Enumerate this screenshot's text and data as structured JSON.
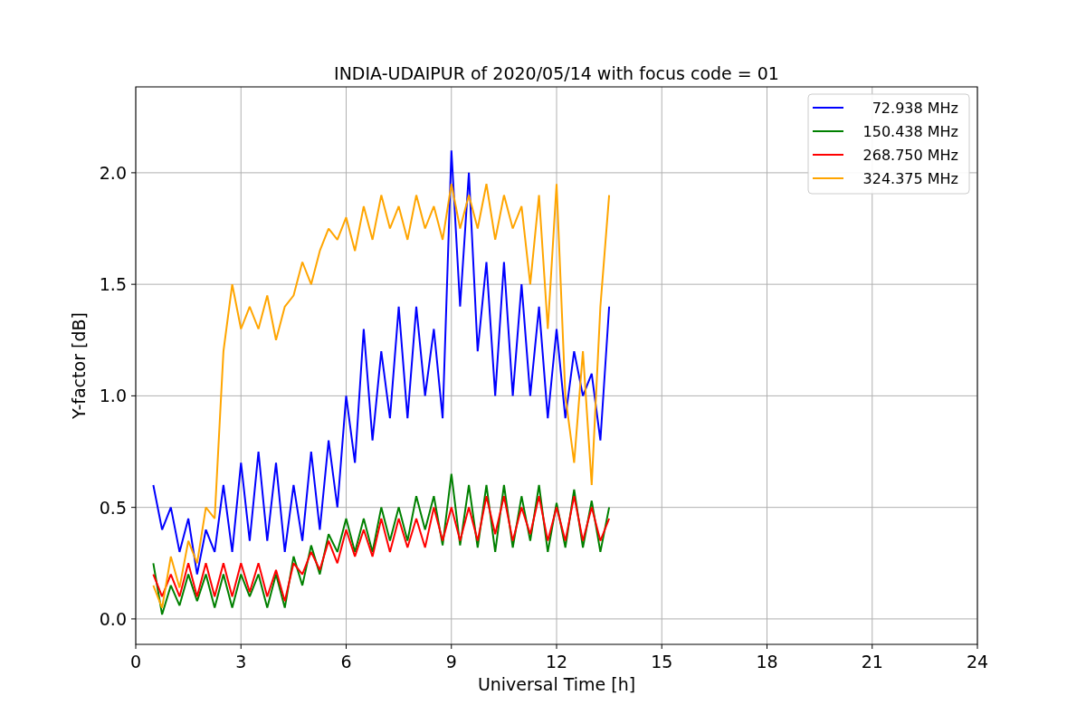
{
  "figure": {
    "chart_data": {
      "type": "line",
      "title": "INDIA-UDAIPUR of 2020/05/14 with focus code = 01",
      "xlabel": "Universal Time [h]",
      "ylabel": "Y-factor [dB]",
      "x": [
        0.5,
        0.75,
        1.0,
        1.25,
        1.5,
        1.75,
        2.0,
        2.25,
        2.5,
        2.75,
        3.0,
        3.25,
        3.5,
        3.75,
        4.0,
        4.25,
        4.5,
        4.75,
        5.0,
        5.25,
        5.5,
        5.75,
        6.0,
        6.25,
        6.5,
        6.75,
        7.0,
        7.25,
        7.5,
        7.75,
        8.0,
        8.25,
        8.5,
        8.75,
        9.0,
        9.25,
        9.5,
        9.75,
        10.0,
        10.25,
        10.5,
        10.75,
        11.0,
        11.25,
        11.5,
        11.75,
        12.0,
        12.25,
        12.5,
        12.75,
        13.0,
        13.25,
        13.5
      ],
      "series": [
        {
          "name": "72.938 MHz",
          "color": "#0000ff",
          "values": [
            0.6,
            0.4,
            0.5,
            0.3,
            0.45,
            0.2,
            0.4,
            0.3,
            0.6,
            0.3,
            0.7,
            0.35,
            0.75,
            0.35,
            0.7,
            0.3,
            0.6,
            0.35,
            0.75,
            0.4,
            0.8,
            0.5,
            1.0,
            0.7,
            1.3,
            0.8,
            1.2,
            0.9,
            1.4,
            0.9,
            1.4,
            1.0,
            1.3,
            0.9,
            2.1,
            1.4,
            2.0,
            1.2,
            1.6,
            1.0,
            1.6,
            1.0,
            1.5,
            1.0,
            1.4,
            0.9,
            1.3,
            0.9,
            1.2,
            1.0,
            1.1,
            0.8,
            1.4
          ]
        },
        {
          "name": "150.438 MHz",
          "color": "#008000",
          "values": [
            0.25,
            0.02,
            0.15,
            0.06,
            0.2,
            0.08,
            0.2,
            0.05,
            0.2,
            0.05,
            0.2,
            0.1,
            0.2,
            0.05,
            0.2,
            0.05,
            0.28,
            0.15,
            0.33,
            0.2,
            0.38,
            0.3,
            0.45,
            0.3,
            0.45,
            0.3,
            0.5,
            0.35,
            0.5,
            0.35,
            0.55,
            0.4,
            0.55,
            0.33,
            0.65,
            0.33,
            0.6,
            0.32,
            0.6,
            0.3,
            0.6,
            0.32,
            0.55,
            0.35,
            0.6,
            0.3,
            0.52,
            0.32,
            0.58,
            0.32,
            0.53,
            0.3,
            0.5
          ]
        },
        {
          "name": "268.750 MHz",
          "color": "#ff0000",
          "values": [
            0.2,
            0.1,
            0.2,
            0.1,
            0.25,
            0.1,
            0.25,
            0.1,
            0.25,
            0.1,
            0.25,
            0.12,
            0.25,
            0.1,
            0.22,
            0.08,
            0.25,
            0.2,
            0.3,
            0.22,
            0.35,
            0.25,
            0.4,
            0.28,
            0.4,
            0.28,
            0.45,
            0.3,
            0.45,
            0.32,
            0.45,
            0.32,
            0.5,
            0.35,
            0.5,
            0.35,
            0.5,
            0.35,
            0.55,
            0.38,
            0.55,
            0.35,
            0.5,
            0.38,
            0.55,
            0.35,
            0.5,
            0.35,
            0.55,
            0.35,
            0.5,
            0.35,
            0.45
          ]
        },
        {
          "name": "324.375 MHz",
          "color": "#ffa500",
          "values": [
            0.15,
            0.05,
            0.28,
            0.14,
            0.35,
            0.25,
            0.5,
            0.45,
            1.2,
            1.5,
            1.3,
            1.4,
            1.3,
            1.45,
            1.25,
            1.4,
            1.45,
            1.6,
            1.5,
            1.65,
            1.75,
            1.7,
            1.8,
            1.65,
            1.85,
            1.7,
            1.9,
            1.75,
            1.85,
            1.7,
            1.9,
            1.75,
            1.85,
            1.7,
            1.95,
            1.75,
            1.9,
            1.75,
            1.95,
            1.7,
            1.9,
            1.75,
            1.85,
            1.5,
            1.9,
            1.3,
            1.95,
            1.0,
            0.7,
            1.2,
            0.6,
            1.4,
            1.9
          ]
        }
      ],
      "grid": true,
      "legend": "upper right",
      "xlim": [
        0,
        24
      ],
      "ylim": [
        -0.114,
        2.385
      ],
      "xticks": [
        0,
        3,
        6,
        9,
        12,
        15,
        18,
        21,
        24
      ],
      "yticks": [
        {
          "value": 0,
          "label": "0.0"
        },
        {
          "value": 0.5,
          "label": "0.5"
        },
        {
          "value": 1,
          "label": "1.0"
        },
        {
          "value": 1.5,
          "label": "1.5"
        },
        {
          "value": 2,
          "label": "2.0"
        }
      ]
    }
  }
}
